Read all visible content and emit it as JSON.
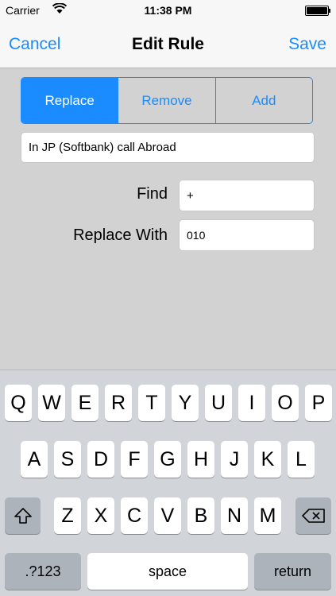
{
  "status_bar": {
    "carrier": "Carrier",
    "time": "11:38 PM"
  },
  "nav": {
    "cancel_label": "Cancel",
    "title": "Edit Rule",
    "save_label": "Save"
  },
  "segments": [
    {
      "label": "Replace",
      "selected": true
    },
    {
      "label": "Remove",
      "selected": false
    },
    {
      "label": "Add",
      "selected": false
    }
  ],
  "form": {
    "rule_name_value": "In JP (Softbank) call Abroad",
    "find_label": "Find",
    "find_value": "+",
    "replace_label": "Replace With",
    "replace_value": "010"
  },
  "keyboard": {
    "row1": [
      "Q",
      "W",
      "E",
      "R",
      "T",
      "Y",
      "U",
      "I",
      "O",
      "P"
    ],
    "row2": [
      "A",
      "S",
      "D",
      "F",
      "G",
      "H",
      "J",
      "K",
      "L"
    ],
    "row3": [
      "Z",
      "X",
      "C",
      "V",
      "B",
      "N",
      "M"
    ],
    "numbers_label": ".?123",
    "space_label": "space",
    "return_label": "return",
    "shift_icon": "shift-icon",
    "delete_icon": "backspace-icon"
  },
  "colors": {
    "accent": "#1a8cff",
    "background": "#d2d2d2",
    "keyboard_bg": "#d1d4d9"
  }
}
